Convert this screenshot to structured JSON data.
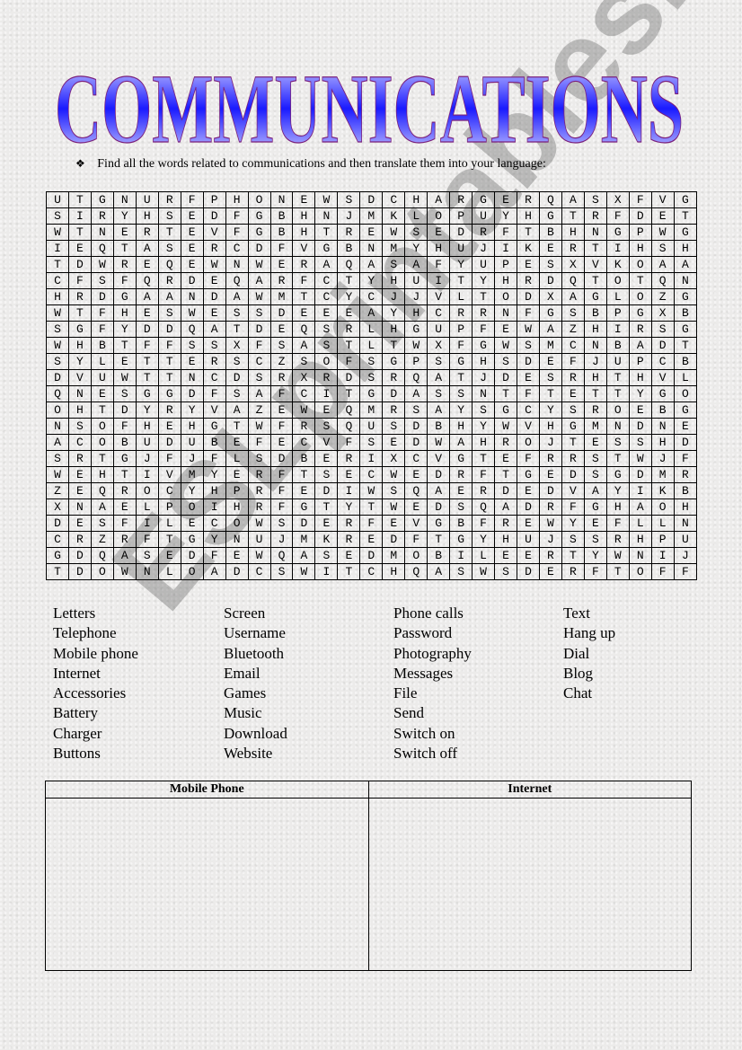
{
  "title": "COMMUNICATIONS",
  "title_colors": {
    "fill_center": "#1a1aff",
    "fill_edge": "#e8e8ff",
    "outline": "#7a1f7a"
  },
  "instruction": {
    "bullet_icon": "❖",
    "text": "Find all the words related to communications and then translate them into your  language:"
  },
  "grid": [
    "UTGNURFPHONEWSDCHARGERQASXFVG",
    "SIRYHSEDFGBHNJMKLOPUYHGTRFDET",
    "WTNERTEVFGBHTREWSEDRFTBHNGPWG",
    "IEQTASERCDFVGBNMYHUJIKERTIHSH",
    "TDWREQEWNWERAQASAFYUPESXVKOAA",
    "CFSFQRDEQARFCTYHUITYHRDQTOTQN",
    "HRDGAANDAWMTCYCJJVLTODXAGLOZG",
    "WTFHESWESSDEEEAYHCRRNFGSBPGXB",
    "SGFYDDQATDEQSRLHGUPFEWAZHIRSG",
    "WHBTFFSSXFSASTLTWXFGWSMCNBADT",
    "SYLETTERSCZSOFSGPSGHSDEFJUPCB",
    "DVUWTTNCDSRXRDSRQATJDESRHTHVL",
    "QNESGGDFSAFCITGDASSNTFTETTYGO",
    "OHTDYRYVAZEWEQMRSAYSGCYSROEBG",
    "NSOFHEHGTWFRSQUSDBHYWVHGMNDNE",
    "ACOBUDUBEFECVFSEDWAHROJTESSHD",
    "SRTGJFJFLSDBERIXCVGTEFRRSTWJF",
    "WEHTIVMYERFTSECWEDRFTGEDSGDMR",
    "ZEQROCYHPRFEDIWSQAERDEDVAYIKB",
    "XNAELPOIHRFGTYTWEDSQADRFGHAOH",
    "DESFILECOWSDERFEVGBFREWYEFLLN",
    "CRZRFTGYNUJMKREDFTGYHUJSSRHPU",
    "GDQASEDFEWQASEDMOBILEERTYWNIJ",
    "TDOWNLOADCSWITCHQASWSDERFTOFF"
  ],
  "word_columns": [
    [
      "Letters",
      "Telephone",
      "Mobile phone",
      "Internet",
      "Accessories",
      "Battery",
      "Charger",
      "Buttons"
    ],
    [
      "Screen",
      "Username",
      "Bluetooth",
      "Email",
      "Games",
      "Music",
      "Download",
      "Website"
    ],
    [
      "Phone calls",
      "Password",
      "Photography",
      "Messages",
      "File",
      "Send",
      "Switch on",
      "Switch off"
    ],
    [
      "Text",
      "Hang up",
      "Dial",
      "Blog",
      "Chat"
    ]
  ],
  "answer_table": {
    "headers": [
      "Mobile Phone",
      "Internet"
    ]
  },
  "watermark": "ESLprintables.com"
}
